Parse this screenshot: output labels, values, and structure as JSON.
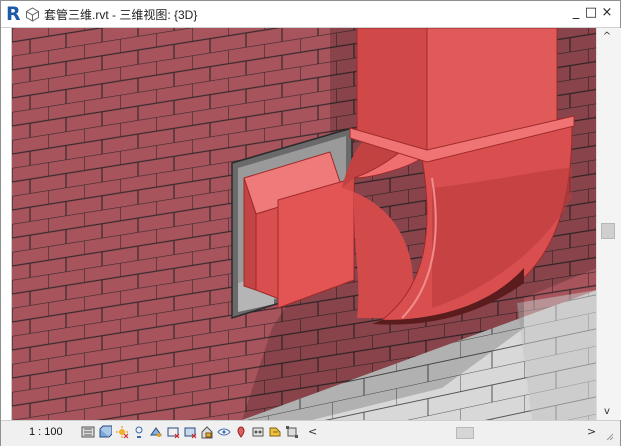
{
  "window": {
    "title": "套管三维.rvt - 三维视图: {3D}",
    "minimize_label": "_",
    "maximize_label": "□",
    "close_label": "×"
  },
  "icons": {
    "app": "revit-logo-icon",
    "view": "3d-view-icon"
  },
  "statusbar": {
    "scale": "1 : 100",
    "left_arrow": "<",
    "right_arrow": ">",
    "tools": [
      "detail-level-icon",
      "visual-style-icon",
      "sun-path-icon",
      "shadows-icon",
      "render-icon",
      "crop-view-icon",
      "show-crop-icon",
      "unlock-3d-icon",
      "temp-hide-icon",
      "reveal-hidden-icon",
      "analytical-model-icon",
      "highlight-displacement-icon",
      "constraints-icon"
    ]
  },
  "scrollbar": {
    "up_arrow": "^",
    "down_arrow": "v"
  },
  "colors": {
    "brick_face": "#a8545c",
    "mortar": "#3a2a2e",
    "duct_fill": "#e05a5a",
    "duct_shadow": "#6a1e1e",
    "sleeve": "#9a9a9a",
    "block_face": "#d8d8d8"
  }
}
